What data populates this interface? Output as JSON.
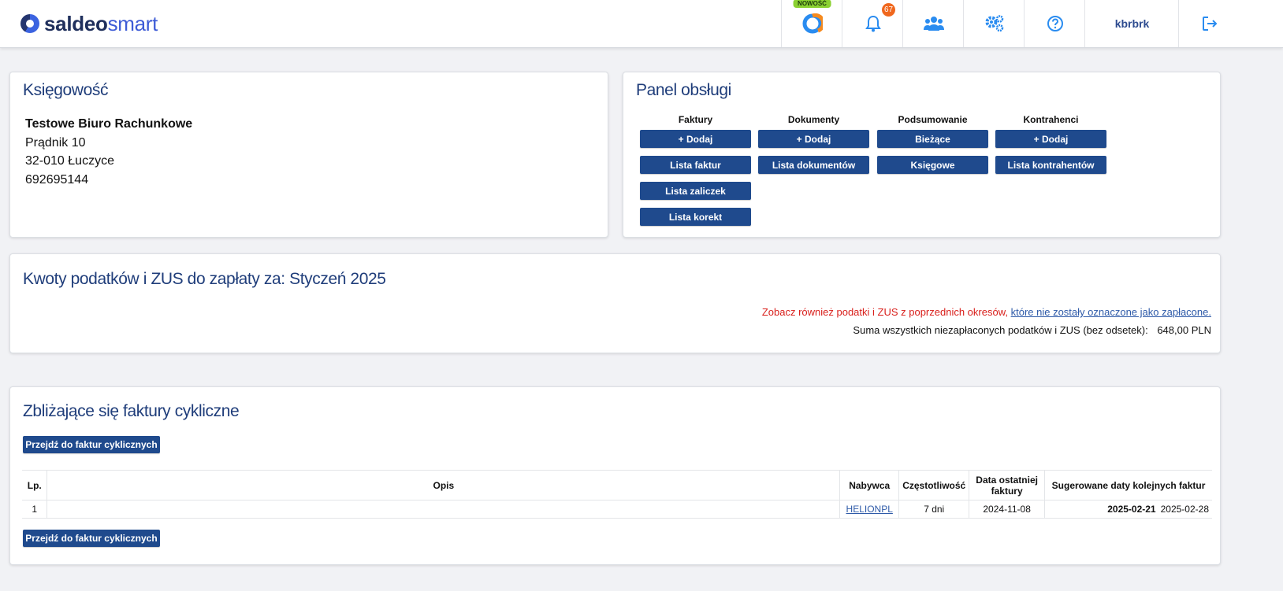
{
  "header": {
    "logo_bold": "saldeo",
    "logo_light": "smart",
    "new_badge": "NOWOŚĆ",
    "notification_count": "67",
    "user": "kbrbrk"
  },
  "accounting": {
    "title": "Księgowość",
    "company": "Testowe Biuro Rachunkowe",
    "street": "Prądnik 10",
    "city": "32-010 Łuczyce",
    "phone": "692695144"
  },
  "panel": {
    "title": "Panel obsługi",
    "columns": [
      {
        "heading": "Faktury",
        "buttons": [
          "+ Dodaj",
          "Lista faktur",
          "Lista zaliczek",
          "Lista korekt"
        ]
      },
      {
        "heading": "Dokumenty",
        "buttons": [
          "+ Dodaj",
          "Lista dokumentów"
        ]
      },
      {
        "heading": "Podsumowanie",
        "buttons": [
          "Bieżące",
          "Księgowe"
        ]
      },
      {
        "heading": "Kontrahenci",
        "buttons": [
          "+ Dodaj",
          "Lista kontrahentów"
        ]
      }
    ]
  },
  "taxes": {
    "title": "Kwoty podatków i ZUS do zapłaty za: Styczeń 2025",
    "notice_red": "Zobacz również podatki i ZUS z poprzednich okresów,",
    "notice_link": "które nie zostały oznaczone jako zapłacone.",
    "sum_label": "Suma wszystkich niezapłaconych podatków i ZUS (bez odsetek):",
    "sum_value": "648,00 PLN"
  },
  "cyclic": {
    "title": "Zbliżające się faktury cykliczne",
    "goto_button": "Przejdź do faktur cyklicznych",
    "headers": {
      "lp": "Lp.",
      "opis": "Opis",
      "nabywca": "Nabywca",
      "czestotliwosc": "Częstotliwość",
      "data_line1": "Data ostatniej",
      "data_line2": "faktury",
      "sugerowane": "Sugerowane daty kolejnych faktur"
    },
    "rows": [
      {
        "lp": "1",
        "opis": "",
        "nabywca": "HELIONPL",
        "czestotliwosc": "7 dni",
        "data": "2024-11-08",
        "next1": "2025-02-21",
        "next2": "2025-02-28"
      }
    ]
  }
}
